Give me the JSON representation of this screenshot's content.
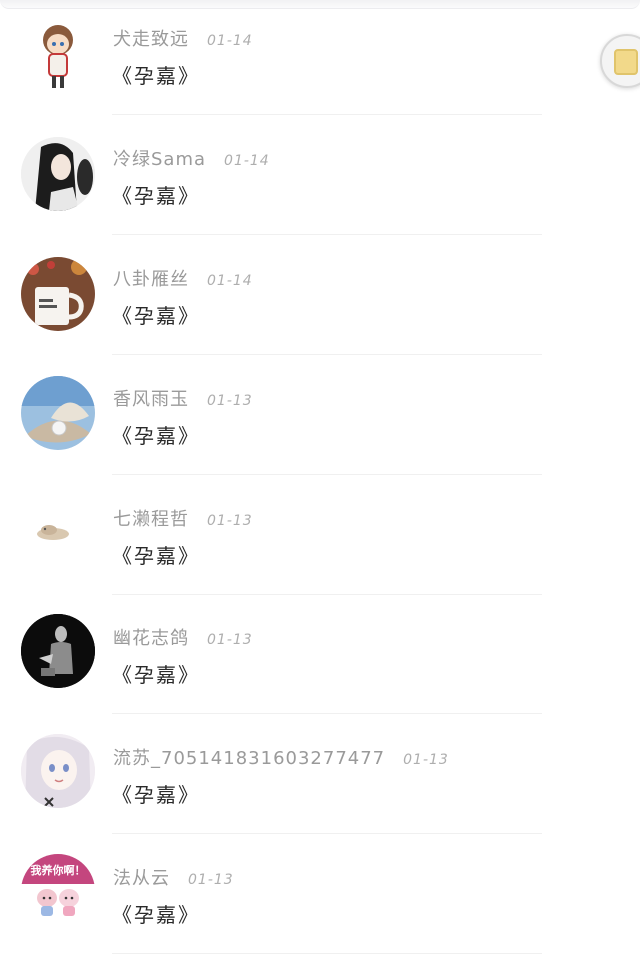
{
  "comments": [
    {
      "user": "犬走致远",
      "date": "01-14",
      "text": "《孕嘉》",
      "avatar": "chibi-boy-avatar"
    },
    {
      "user": "冷绿Sama",
      "date": "01-14",
      "text": "《孕嘉》",
      "avatar": "longhair-figure-avatar"
    },
    {
      "user": "八卦雁丝",
      "date": "01-14",
      "text": "《孕嘉》",
      "avatar": "coffee-mug-avatar"
    },
    {
      "user": "香风雨玉",
      "date": "01-13",
      "text": "《孕嘉》",
      "avatar": "pearl-shell-avatar"
    },
    {
      "user": "七濑程哲",
      "date": "01-13",
      "text": "《孕嘉》",
      "avatar": "small-creature-avatar"
    },
    {
      "user": "幽花志鸽",
      "date": "01-13",
      "text": "《孕嘉》",
      "avatar": "dark-figure-avatar"
    },
    {
      "user": "流苏_705141831603277477",
      "date": "01-13",
      "text": "《孕嘉》",
      "avatar": "anime-girl-avatar"
    },
    {
      "user": "法从云",
      "date": "01-13",
      "text": "《孕嘉》",
      "avatar": "couple-sticker-avatar",
      "avatar_text": "我养你啊！"
    }
  ]
}
